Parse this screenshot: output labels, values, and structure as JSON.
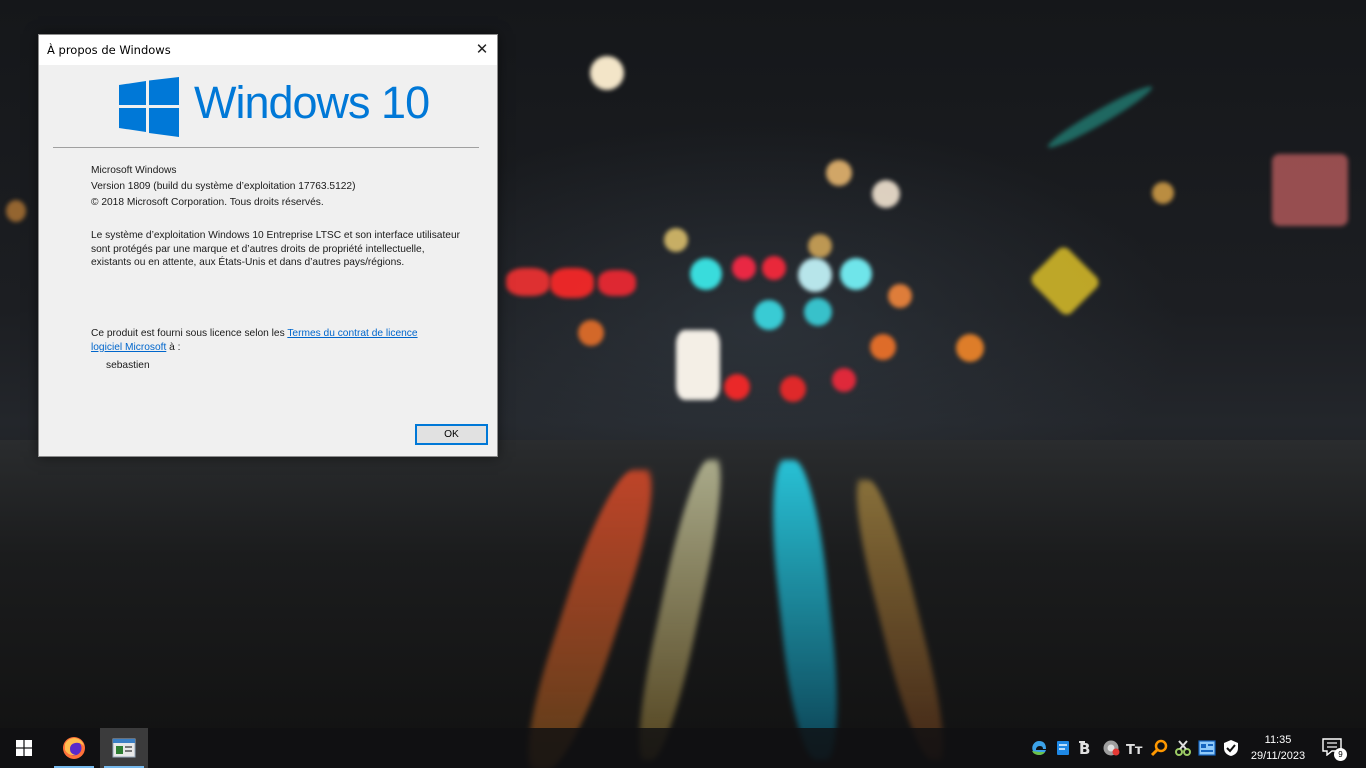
{
  "dialog": {
    "title": "À propos de Windows",
    "close_symbol": "✕",
    "logo_text": "Windows 10",
    "product_name": "Microsoft Windows",
    "version": "Version 1809 (build du système d’exploitation 17763.5122)",
    "copyright": "© 2018 Microsoft Corporation. Tous droits réservés.",
    "legal_text": "Le système d’exploitation Windows 10 Entreprise LTSC et son interface utilisateur sont protégés par une marque et d’autres droits de propriété intellectuelle, existants ou en attente, aux États-Unis et dans d’autres pays/régions.",
    "license_prefix": "Ce produit est fourni sous licence selon les ",
    "license_link": "Termes du contrat de licence logiciel Microsoft",
    "license_suffix": " à :",
    "licensed_user": "sebastien",
    "ok_label": "OK"
  },
  "taskbar": {
    "pinned_apps": [
      {
        "name": "firefox-icon"
      },
      {
        "name": "window-app-icon"
      }
    ],
    "tray_icons": [
      "edge-icon",
      "files-icon",
      "typora-icon",
      "chrome-icon",
      "font-icon",
      "search-tool-icon",
      "tools-icon",
      "app-window-icon",
      "shield-icon"
    ],
    "clock_time": "11:35",
    "clock_date": "29/11/2023",
    "notification_count": "9"
  },
  "colors": {
    "windows_blue": "#0078d7",
    "link": "#0066cc",
    "taskbar": "#101012"
  }
}
